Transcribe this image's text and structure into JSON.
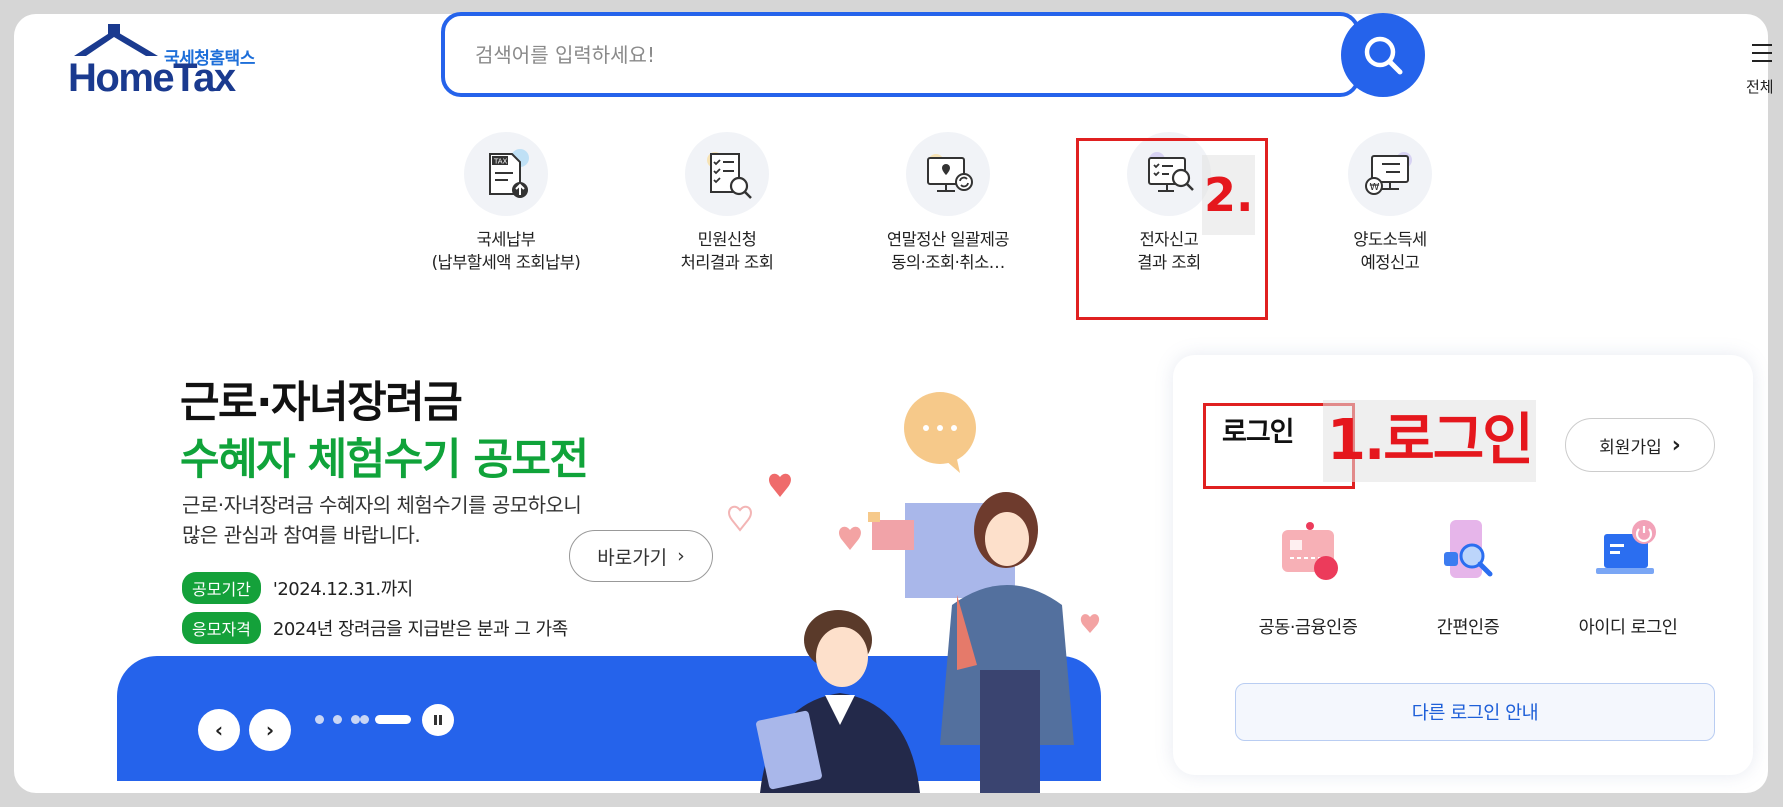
{
  "header": {
    "logo_kr": "국세청홈택스",
    "logo_en": "HomeTax",
    "search_placeholder": "검색어를 입력하세요!",
    "all_menu_label": "전체"
  },
  "quick_menu": [
    {
      "label": "국세납부\n(납부할세액 조회납부)",
      "icon": "tax-payment-icon"
    },
    {
      "label": "민원신청\n처리결과 조회",
      "icon": "document-search-icon"
    },
    {
      "label": "연말정산 일괄제공\n동의·조회·취소…",
      "icon": "monitor-location-icon"
    },
    {
      "label": "전자신고\n결과 조회",
      "icon": "monitor-search-icon"
    },
    {
      "label": "양도소득세\n예정신고",
      "icon": "monitor-won-icon"
    }
  ],
  "annotations": {
    "step1": "1.로그인",
    "step2": "2."
  },
  "banner": {
    "title_line1": "근로·자녀장려금",
    "title_line2": "수혜자 체험수기 공모전",
    "description": "근로·자녀장려금 수혜자의 체험수기를 공모하오니\n많은 관심과 참여를 바랍니다.",
    "period_label": "공모기간",
    "period_value": "'2024.12.31.까지",
    "eligibility_label": "응모자격",
    "eligibility_value": "2024년 장려금을 지급받은 분과 그 가족",
    "go_button": "바로가기",
    "slide_total": 5,
    "slide_active": 5
  },
  "login": {
    "title": "로그인",
    "signup_button": "회원가입",
    "options": [
      {
        "label": "공동·금융인증",
        "icon": "certificate-icon"
      },
      {
        "label": "간편인증",
        "icon": "phone-search-icon"
      },
      {
        "label": "아이디 로그인",
        "icon": "laptop-power-icon"
      }
    ],
    "other_login": "다른 로그인 안내"
  },
  "colors": {
    "primary": "#2563eb",
    "green": "#14a13a",
    "annotation_red": "#e02020"
  }
}
